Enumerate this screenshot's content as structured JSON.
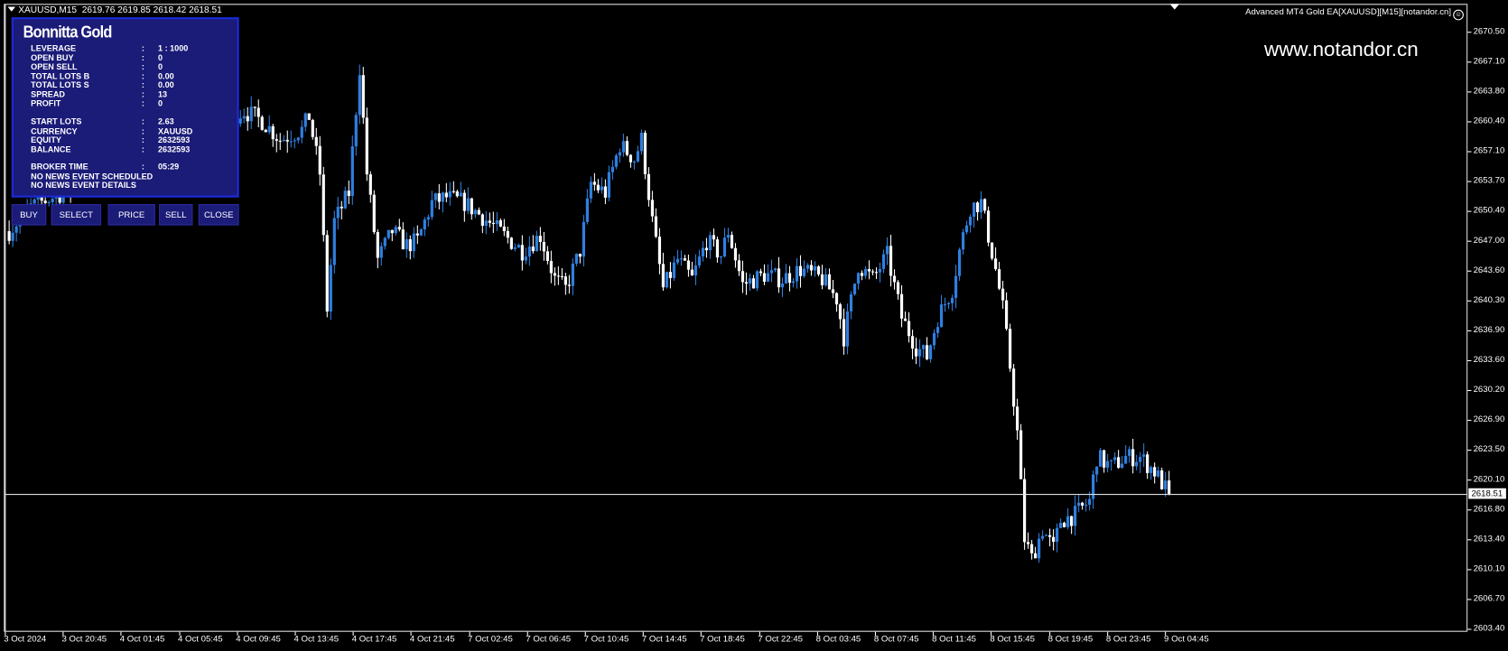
{
  "header": {
    "symbol_line": "XAUUSD,M15  2619.76 2619.85 2618.42 2618.51",
    "ea_label": "Advanced MT4 Gold EA[XAUUSD][M15][notandor.cn]",
    "smiley_icon": "smiley-face",
    "watermark": "www.notandor.cn"
  },
  "panel": {
    "title": "Bonnitta Gold",
    "rows": [
      {
        "label": "LEVERAGE",
        "sep": ":",
        "value": "1 : 1000"
      },
      {
        "label": "OPEN BUY",
        "sep": ":",
        "value": "0"
      },
      {
        "label": "OPEN SELL",
        "sep": ":",
        "value": "0"
      },
      {
        "label": "TOTAL LOTS B",
        "sep": ":",
        "value": "0.00"
      },
      {
        "label": "TOTAL LOTS S",
        "sep": ":",
        "value": "0.00"
      },
      {
        "label": "SPREAD",
        "sep": ":",
        "value": "13"
      },
      {
        "label": "PROFIT",
        "sep": ":",
        "value": "0"
      },
      {
        "label": "START LOTS",
        "sep": ":",
        "value": "2.63"
      },
      {
        "label": "CURRENCY",
        "sep": ":",
        "value": "XAUUSD"
      },
      {
        "label": "EQUITY",
        "sep": ":",
        "value": "2632593"
      },
      {
        "label": "BALANCE",
        "sep": ":",
        "value": "2632593"
      },
      {
        "label": "BROKER TIME",
        "sep": ":",
        "value": "05:29"
      },
      {
        "label": "NO NEWS EVENT SCHEDULED",
        "sep": "",
        "value": ""
      },
      {
        "label": "NO NEWS EVENT DETAILS",
        "sep": "",
        "value": ""
      }
    ]
  },
  "buttons": [
    "BUY",
    "SELECT",
    "PRICE",
    "SELL",
    "CLOSE"
  ],
  "colors": {
    "bull": "#2f7fe0",
    "bear": "#ffffff",
    "panel": "#1b1b78",
    "panel_border": "#1a2bd8"
  },
  "chart_data": {
    "type": "candlestick",
    "symbol": "XAUUSD",
    "timeframe": "M15",
    "current_price": "2618.51",
    "ylim": [
      2603.4,
      2670.5
    ],
    "price_ticks": [
      "2670.50",
      "2667.10",
      "2663.80",
      "2660.40",
      "2657.10",
      "2653.70",
      "2650.40",
      "2647.00",
      "2643.60",
      "2640.30",
      "2636.90",
      "2633.60",
      "2630.20",
      "2626.90",
      "2623.50",
      "2620.10",
      "2616.80",
      "2613.40",
      "2610.10",
      "2606.70",
      "2603.40"
    ],
    "time_ticks": [
      "3 Oct 2024",
      "3 Oct 20:45",
      "4 Oct 01:45",
      "4 Oct 05:45",
      "4 Oct 09:45",
      "4 Oct 13:45",
      "4 Oct 17:45",
      "4 Oct 21:45",
      "7 Oct 02:45",
      "7 Oct 06:45",
      "7 Oct 10:45",
      "7 Oct 14:45",
      "7 Oct 18:45",
      "7 Oct 22:45",
      "8 Oct 03:45",
      "8 Oct 07:45",
      "8 Oct 11:45",
      "8 Oct 15:45",
      "8 Oct 19:45",
      "8 Oct 23:45",
      "9 Oct 04:45"
    ],
    "bars_per_time_tick": 16,
    "close_path": [
      [
        0,
        2648.1
      ],
      [
        6,
        2650.8
      ],
      [
        65,
        2661.6
      ],
      [
        70,
        2660.5
      ],
      [
        75,
        2658.4
      ],
      [
        81,
        2659.5
      ],
      [
        83,
        2661
      ],
      [
        86,
        2654.6
      ],
      [
        88,
        2639.4
      ],
      [
        90,
        2649.2
      ],
      [
        94,
        2652.4
      ],
      [
        97,
        2666.5
      ],
      [
        99,
        2654.6
      ],
      [
        102,
        2644.9
      ],
      [
        106,
        2648.1
      ],
      [
        110,
        2646.5
      ],
      [
        113,
        2647
      ],
      [
        117,
        2651.3
      ],
      [
        121,
        2651.9
      ],
      [
        126,
        2651.3
      ],
      [
        131,
        2649.7
      ],
      [
        137,
        2647.6
      ],
      [
        142,
        2645.9
      ],
      [
        147,
        2647.6
      ],
      [
        151,
        2642.7
      ],
      [
        154,
        2641.6
      ],
      [
        158,
        2645.9
      ],
      [
        161,
        2653.5
      ],
      [
        165,
        2652.4
      ],
      [
        169,
        2657.8
      ],
      [
        173,
        2656.2
      ],
      [
        175,
        2658.4
      ],
      [
        178,
        2649.2
      ],
      [
        181,
        2641.6
      ],
      [
        185,
        2644.9
      ],
      [
        189,
        2642.7
      ],
      [
        193,
        2647
      ],
      [
        197,
        2645.4
      ],
      [
        199,
        2648.1
      ],
      [
        203,
        2642.1
      ],
      [
        209,
        2643.2
      ],
      [
        214,
        2642.7
      ],
      [
        219,
        2643.8
      ],
      [
        225,
        2642.7
      ],
      [
        229,
        2640.5
      ],
      [
        231,
        2636.2
      ],
      [
        235,
        2644.3
      ],
      [
        239,
        2642.7
      ],
      [
        243,
        2645.4
      ],
      [
        247,
        2638.4
      ],
      [
        251,
        2635.1
      ],
      [
        254,
        2634
      ],
      [
        257,
        2638.4
      ],
      [
        261,
        2641.6
      ],
      [
        263,
        2645.9
      ],
      [
        266,
        2650.8
      ],
      [
        269,
        2651.3
      ],
      [
        273,
        2643.8
      ],
      [
        275,
        2639.4
      ],
      [
        277,
        2632.9
      ],
      [
        279,
        2625.4
      ],
      [
        281,
        2613.5
      ],
      [
        283,
        2611.3
      ],
      [
        286,
        2614.6
      ],
      [
        289,
        2612.4
      ],
      [
        291,
        2615.6
      ],
      [
        295,
        2616.2
      ],
      [
        299,
        2617.8
      ],
      [
        301,
        2622.7
      ],
      [
        305,
        2621.6
      ],
      [
        309,
        2622.7
      ],
      [
        313,
        2622.7
      ],
      [
        317,
        2621.1
      ],
      [
        321,
        2618.51
      ]
    ]
  }
}
